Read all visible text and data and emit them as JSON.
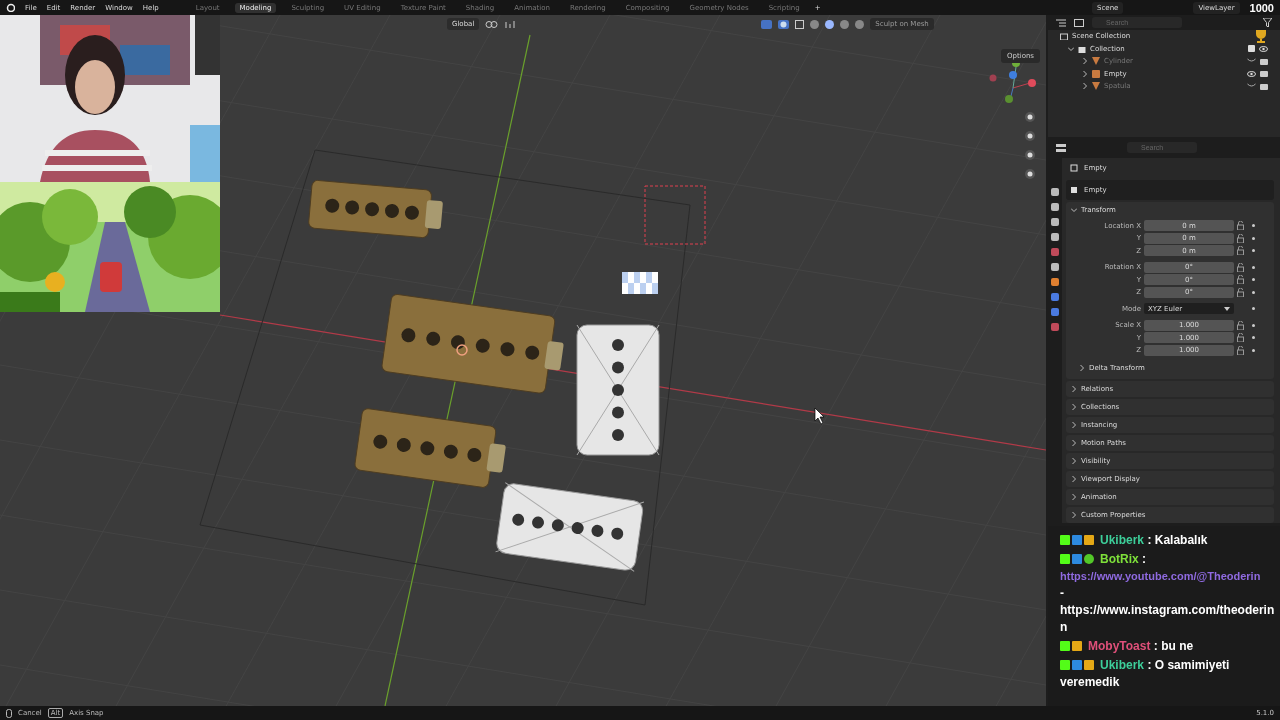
{
  "menu": [
    "File",
    "Edit",
    "Render",
    "Window",
    "Help"
  ],
  "workspaces": [
    {
      "label": "Layout",
      "selected": false
    },
    {
      "label": "Modeling",
      "selected": true
    },
    {
      "label": "Sculpting",
      "selected": false
    },
    {
      "label": "UV Editing",
      "selected": false
    },
    {
      "label": "Texture Paint",
      "selected": false
    },
    {
      "label": "Shading",
      "selected": false
    },
    {
      "label": "Animation",
      "selected": false
    },
    {
      "label": "Rendering",
      "selected": false
    },
    {
      "label": "Compositing",
      "selected": false
    },
    {
      "label": "Geometry Nodes",
      "selected": false
    },
    {
      "label": "Scripting",
      "selected": false
    }
  ],
  "add_workspace": "+",
  "scene": "Scene",
  "view_layer": "ViewLayer",
  "points": "1000",
  "viewport": {
    "orientation": "Global",
    "sculpt_button": "Sculpt on Mesh",
    "options": "Options",
    "shading": [
      {
        "selected": false
      },
      {
        "selected": true
      },
      {
        "selected": false
      },
      {
        "selected": false
      }
    ]
  },
  "outliner": {
    "search_placeholder": "Search",
    "root": "Scene Collection",
    "collection": {
      "name": "Collection",
      "expanded": true,
      "children": [
        {
          "name": "Cylinder",
          "visible": false,
          "kind": "mesh"
        },
        {
          "name": "Empty",
          "visible": true,
          "kind": "empty"
        },
        {
          "name": "Spatula",
          "visible": false,
          "kind": "mesh"
        }
      ]
    }
  },
  "properties": {
    "search_placeholder": "Search",
    "object_name": "Empty",
    "data_name": "Empty",
    "transform": {
      "label": "Transform",
      "expanded": true,
      "groups": [
        {
          "rows": [
            {
              "label": "Location X",
              "value": "0 m",
              "kind": "number"
            },
            {
              "label": "Y",
              "value": "0 m",
              "kind": "number"
            },
            {
              "label": "Z",
              "value": "0 m",
              "kind": "number"
            }
          ]
        },
        {
          "rows": [
            {
              "label": "Rotation X",
              "value": "0°",
              "kind": "number"
            },
            {
              "label": "Y",
              "value": "0°",
              "kind": "number"
            },
            {
              "label": "Z",
              "value": "0°",
              "kind": "number"
            }
          ]
        },
        {
          "rows": [
            {
              "label": "Mode",
              "value": "XYZ Euler",
              "kind": "select"
            }
          ]
        },
        {
          "rows": [
            {
              "label": "Scale X",
              "value": "1.000",
              "kind": "number"
            },
            {
              "label": "Y",
              "value": "1.000",
              "kind": "number"
            },
            {
              "label": "Z",
              "value": "1.000",
              "kind": "number"
            }
          ]
        }
      ],
      "subpanel": {
        "label": "Delta Transform",
        "expanded": false
      }
    },
    "panels": [
      {
        "label": "Relations",
        "expanded": false
      },
      {
        "label": "Collections",
        "expanded": false
      },
      {
        "label": "Instancing",
        "expanded": false
      },
      {
        "label": "Motion Paths",
        "expanded": false
      },
      {
        "label": "Visibility",
        "expanded": false
      },
      {
        "label": "Viewport Display",
        "expanded": false
      },
      {
        "label": "Animation",
        "expanded": false
      },
      {
        "label": "Custom Properties",
        "expanded": false
      }
    ]
  },
  "chat": {
    "messages": [
      {
        "badges": [
          {
            "kind": "kick"
          },
          {
            "kind": "mod"
          },
          {
            "kind": "vip"
          }
        ],
        "user": "Ukiberk",
        "color": "#3dcf9a",
        "separator": ":",
        "parts": [
          {
            "kind": "text",
            "text": "Kalabalık"
          }
        ]
      },
      {
        "badges": [
          {
            "kind": "kick"
          },
          {
            "kind": "mod"
          },
          {
            "kind": "verified"
          }
        ],
        "user": "BotRix",
        "color": "#7ee03a",
        "separator": ":",
        "parts": [
          {
            "kind": "link",
            "text": "https://www.youtube.com/@Theoderin"
          },
          {
            "kind": "line",
            "text": "-"
          },
          {
            "kind": "line",
            "text": "https://www.instagram.com/theoderinn"
          }
        ]
      },
      {
        "badges": [
          {
            "kind": "kick"
          },
          {
            "kind": "vip"
          }
        ],
        "user": "MobyToast",
        "color": "#e0507a",
        "separator": ":",
        "parts": [
          {
            "kind": "text",
            "text": "bu ne"
          }
        ]
      },
      {
        "badges": [
          {
            "kind": "kick"
          },
          {
            "kind": "mod"
          },
          {
            "kind": "vip"
          }
        ],
        "user": "Ukiberk",
        "color": "#3dcf9a",
        "separator": ":",
        "parts": [
          {
            "kind": "text",
            "text": "O samimiyeti"
          },
          {
            "kind": "line",
            "text": "veremedik"
          }
        ]
      }
    ]
  },
  "version": "5.1.0",
  "status_bar": [
    {
      "kind": "mouse",
      "label": "Cancel"
    },
    {
      "kind": "key",
      "key": "Alt",
      "label": "Axis Snap"
    }
  ]
}
